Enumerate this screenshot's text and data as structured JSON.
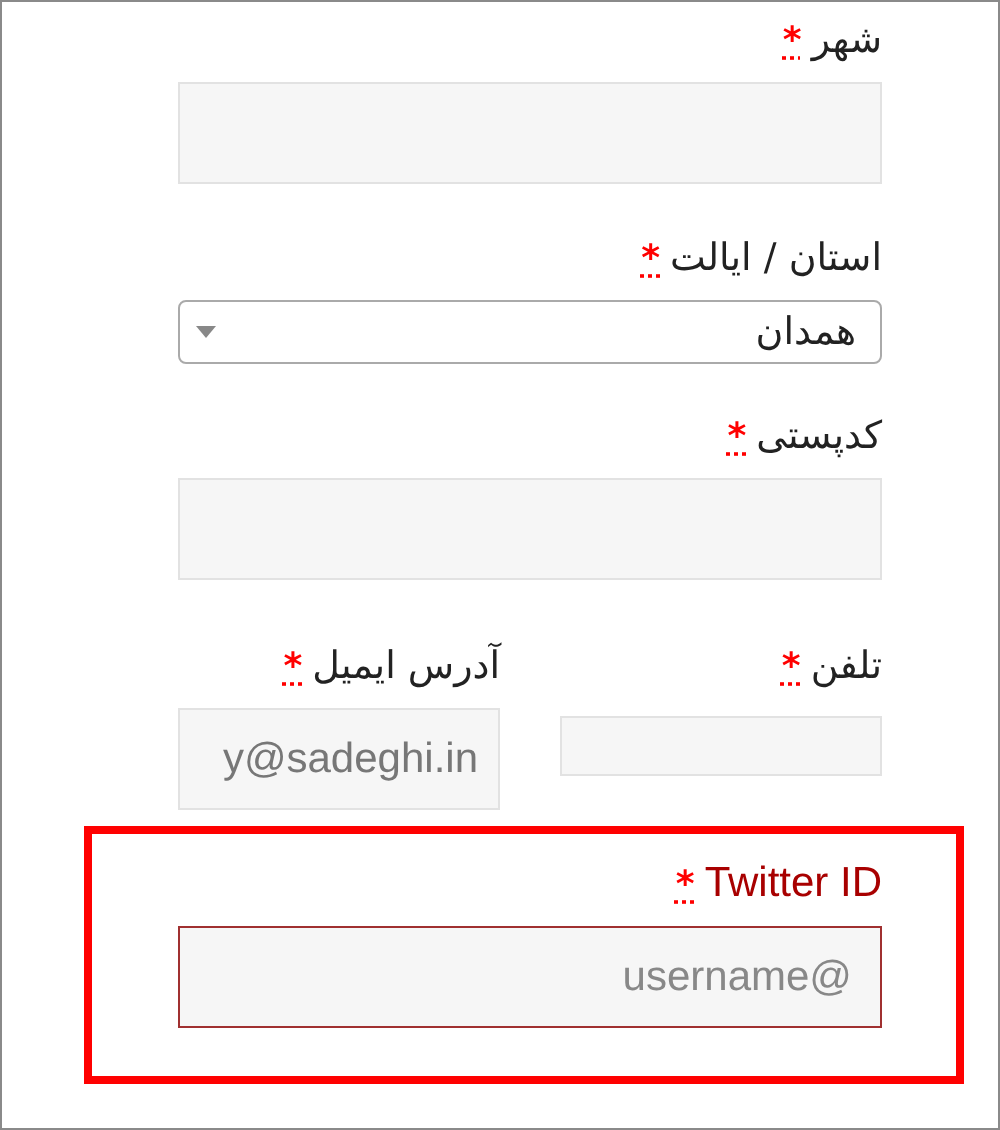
{
  "fields": [
    {
      "kind": "text",
      "label": "شهر",
      "required": "*"
    },
    {
      "kind": "select",
      "label": "استان / ایالت",
      "required": "*",
      "value": "همدان"
    },
    {
      "kind": "text",
      "label": "کدپستی",
      "required": "*"
    }
  ],
  "pair": [
    {
      "label": "تلفن",
      "required": "*"
    },
    {
      "label": "آدرس ایمیل",
      "required": "*",
      "value": "y@sadeghi.in"
    }
  ],
  "twitter": {
    "label": "Twitter ID",
    "required": "*",
    "placeholder": "username@",
    "error": true,
    "highlighted": true
  }
}
